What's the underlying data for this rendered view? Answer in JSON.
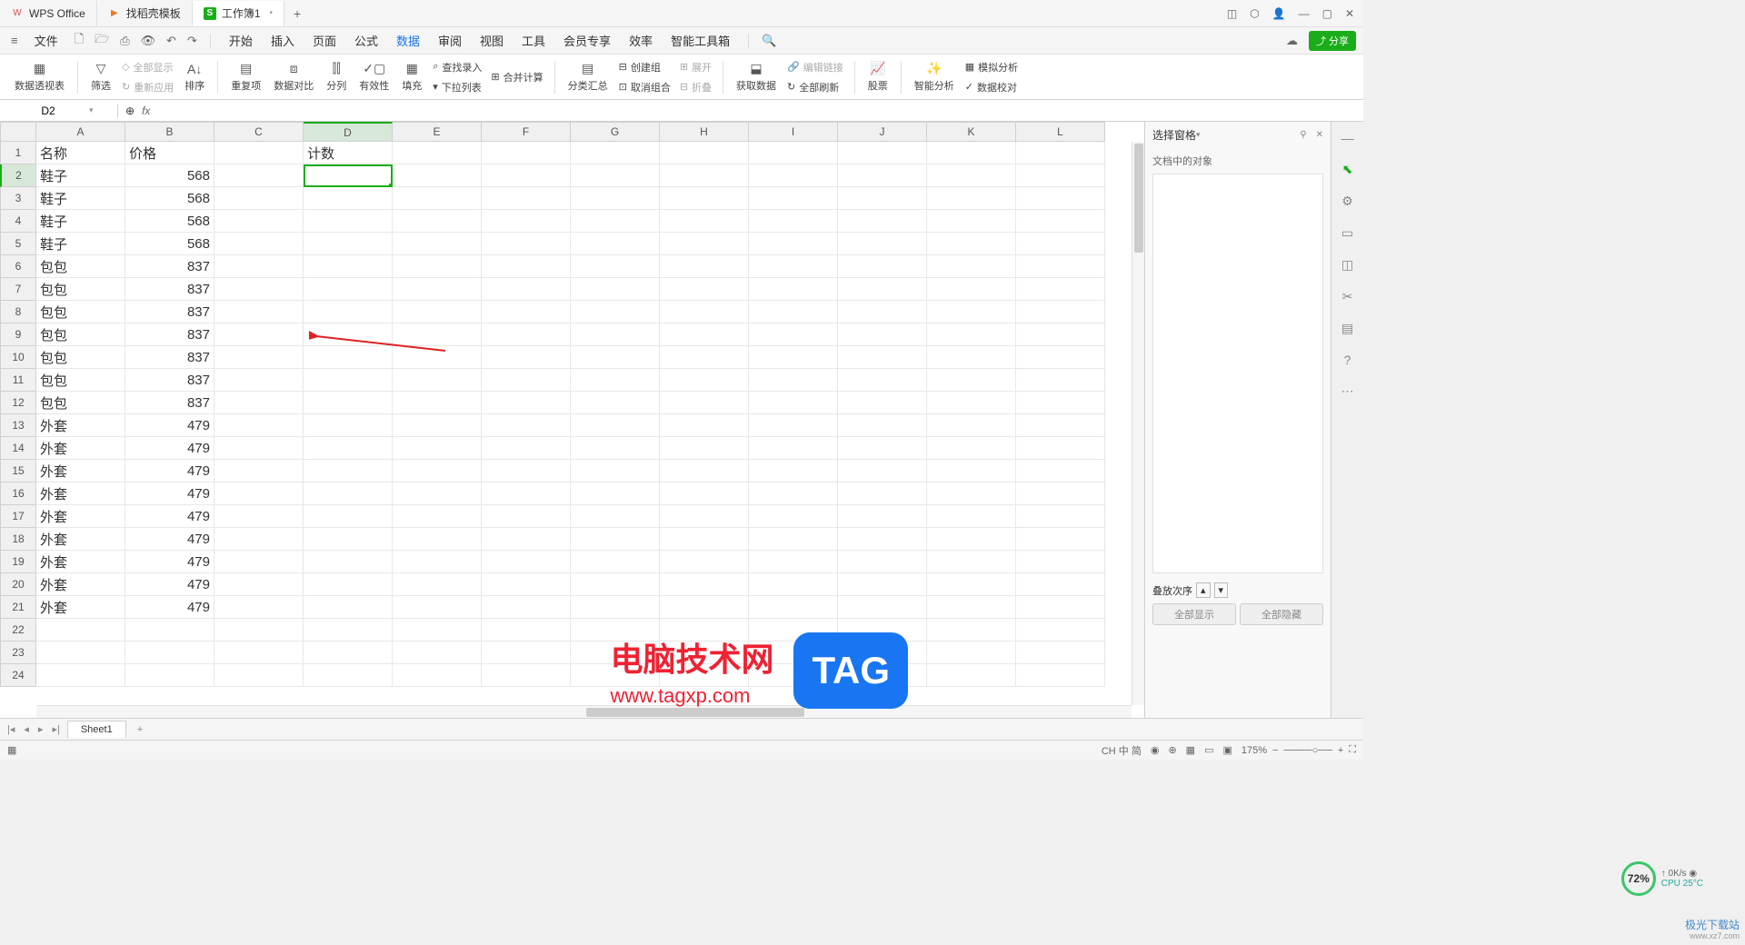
{
  "titlebar": {
    "tabs": [
      {
        "icon": "W",
        "label": "WPS Office"
      },
      {
        "icon": "▶",
        "label": "找稻壳模板"
      },
      {
        "icon": "S",
        "label": "工作簿1",
        "active": true,
        "closable": true
      }
    ],
    "add": "+"
  },
  "menubar": {
    "file": "文件",
    "items": [
      "开始",
      "插入",
      "页面",
      "公式",
      "数据",
      "审阅",
      "视图",
      "工具",
      "会员专享",
      "效率",
      "智能工具箱"
    ],
    "active_index": 4,
    "share": "分享"
  },
  "ribbon": {
    "pivot": "数据透视表",
    "filter": "筛选",
    "show_all": "全部显示",
    "reapply": "重新应用",
    "sort": "排序",
    "dedup": "重复项",
    "compare": "数据对比",
    "split": "分列",
    "validate": "有效性",
    "fill": "填充",
    "lookup": "查找录入",
    "consolidate": "合并计算",
    "dropdown": "下拉列表",
    "subtotal": "分类汇总",
    "group": "创建组",
    "ungroup": "取消组合",
    "expand": "展开",
    "collapse": "折叠",
    "getdata": "获取数据",
    "editlink": "编辑链接",
    "refreshall": "全部刷新",
    "stock": "股票",
    "smart": "智能分析",
    "forecast": "模拟分析",
    "validate2": "数据校对"
  },
  "formulabar": {
    "namebox": "D2",
    "fx": "fx"
  },
  "columns": [
    "A",
    "B",
    "C",
    "D",
    "E",
    "F",
    "G",
    "H",
    "I",
    "J",
    "K",
    "L"
  ],
  "rowcount": 24,
  "active_col": 3,
  "active_row": 2,
  "data": {
    "headers": [
      "名称",
      "价格",
      "",
      "计数"
    ],
    "rows": [
      [
        "鞋子",
        "568"
      ],
      [
        "鞋子",
        "568"
      ],
      [
        "鞋子",
        "568"
      ],
      [
        "鞋子",
        "568"
      ],
      [
        "包包",
        "837"
      ],
      [
        "包包",
        "837"
      ],
      [
        "包包",
        "837"
      ],
      [
        "包包",
        "837"
      ],
      [
        "包包",
        "837"
      ],
      [
        "包包",
        "837"
      ],
      [
        "包包",
        "837"
      ],
      [
        "外套",
        "479"
      ],
      [
        "外套",
        "479"
      ],
      [
        "外套",
        "479"
      ],
      [
        "外套",
        "479"
      ],
      [
        "外套",
        "479"
      ],
      [
        "外套",
        "479"
      ],
      [
        "外套",
        "479"
      ],
      [
        "外套",
        "479"
      ],
      [
        "外套",
        "479"
      ]
    ]
  },
  "taskpane": {
    "title": "选择窗格",
    "objects_label": "文档中的对象",
    "stack": "叠放次序",
    "showall": "全部显示",
    "hideall": "全部隐藏"
  },
  "sheettabs": {
    "name": "Sheet1"
  },
  "statusbar": {
    "zoom": "175%"
  },
  "cpu": {
    "pct": "72%",
    "net": "0K/s",
    "temp": "CPU 25°C"
  },
  "watermark": {
    "text": "电脑技术网",
    "url": "www.tagxp.com",
    "tag": "TAG"
  },
  "brand": {
    "line1": "极光下载站",
    "line2": "www.xz7.com"
  },
  "ime": "CH 中 简"
}
